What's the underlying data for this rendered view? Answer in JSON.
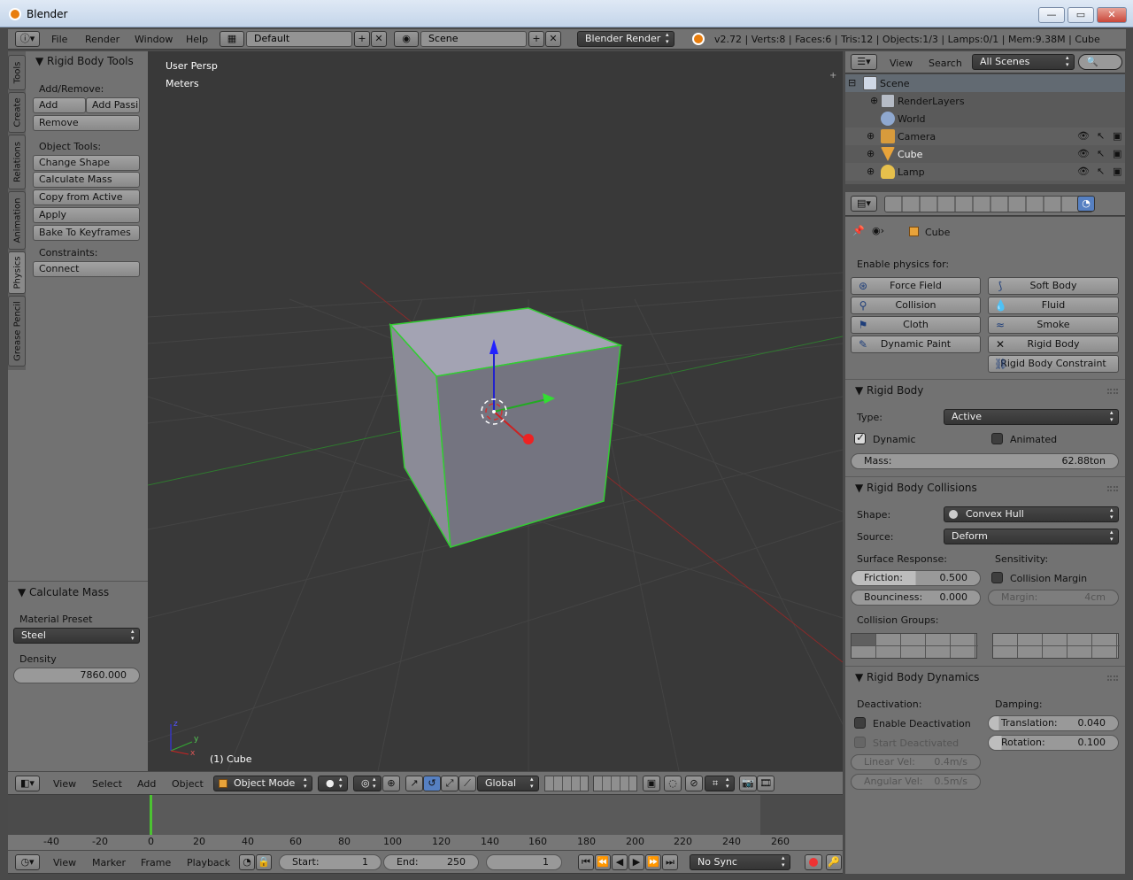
{
  "window": {
    "title": "Blender",
    "min": "—",
    "max": "▭",
    "close": "✕"
  },
  "topbar": {
    "menus": [
      "File",
      "Render",
      "Window",
      "Help"
    ],
    "layout": "Default",
    "scene": "Scene",
    "engine": "Blender Render",
    "stats": "v2.72 | Verts:8 | Faces:6 | Tris:12 | Objects:1/3 | Lamps:0/1 | Mem:9.38M | Cube"
  },
  "tabs": [
    "Tools",
    "Create",
    "Relations",
    "Animation",
    "Physics",
    "Grease Pencil"
  ],
  "toolshelf": {
    "title": "Rigid Body Tools",
    "add_remove": "Add/Remove:",
    "add_active": "Add Activ",
    "add_passive": "Add Passi",
    "remove": "Remove",
    "object_tools": "Object Tools:",
    "change_shape": "Change Shape",
    "calc_mass": "Calculate Mass",
    "copy_active": "Copy from Active",
    "apply_transform": "Apply Transformation",
    "bake": "Bake To Keyframes",
    "constraints": "Constraints:",
    "connect": "Connect"
  },
  "calc_panel": {
    "title": "Calculate Mass",
    "preset_label": "Material Preset",
    "preset": "Steel",
    "density_label": "Density",
    "density": "7860.000"
  },
  "viewport": {
    "persp": "User Persp",
    "units": "Meters",
    "object": "(1) Cube",
    "axis_x": "x",
    "axis_y": "y",
    "axis_z": "z"
  },
  "view3d_header": {
    "menus": [
      "View",
      "Select",
      "Add",
      "Object"
    ],
    "mode": "Object Mode",
    "orientation": "Global"
  },
  "timeline": {
    "ticks": [
      "-40",
      "-20",
      "0",
      "20",
      "40",
      "60",
      "80",
      "100",
      "120",
      "140",
      "160",
      "180",
      "200",
      "220",
      "240",
      "260"
    ],
    "menus": [
      "View",
      "Marker",
      "Frame",
      "Playback"
    ],
    "start_label": "Start:",
    "start": "1",
    "end_label": "End:",
    "end": "250",
    "current": "1",
    "sync": "No Sync"
  },
  "outliner": {
    "menus": [
      "View",
      "Search"
    ],
    "filter": "All Scenes",
    "items": [
      {
        "name": "Scene"
      },
      {
        "name": "RenderLayers"
      },
      {
        "name": "World"
      },
      {
        "name": "Camera"
      },
      {
        "name": "Cube"
      },
      {
        "name": "Lamp"
      }
    ]
  },
  "properties": {
    "context": "Cube",
    "enable_label": "Enable physics for:",
    "buttons_left": [
      "Force Field",
      "Collision",
      "Cloth",
      "Dynamic Paint"
    ],
    "buttons_right": [
      "Soft Body",
      "Fluid",
      "Smoke",
      "Rigid Body",
      "Rigid Body Constraint"
    ],
    "rigid_body": {
      "title": "Rigid Body",
      "type_label": "Type:",
      "type": "Active",
      "dynamic": "Dynamic",
      "animated": "Animated",
      "mass_label": "Mass:",
      "mass": "62.88ton"
    },
    "collisions": {
      "title": "Rigid Body Collisions",
      "shape_label": "Shape:",
      "shape": "Convex Hull",
      "source_label": "Source:",
      "source": "Deform",
      "surface_label": "Surface Response:",
      "sensitivity_label": "Sensitivity:",
      "friction_label": "Friction:",
      "friction": "0.500",
      "bounciness_label": "Bounciness:",
      "bounciness": "0.000",
      "margin_check": "Collision Margin",
      "margin_label": "Margin:",
      "margin": "4cm",
      "groups_label": "Collision Groups:"
    },
    "dynamics": {
      "title": "Rigid Body Dynamics",
      "deact_label": "Deactivation:",
      "damping_label": "Damping:",
      "enable_deact": "Enable Deactivation",
      "start_deact": "Start Deactivated",
      "translation_label": "Translation:",
      "translation": "0.040",
      "rotation_label": "Rotation:",
      "rotation": "0.100",
      "linear_label": "Linear Vel:",
      "linear": "0.4m/s",
      "angular_label": "Angular Vel:",
      "angular": "0.5m/s"
    }
  }
}
